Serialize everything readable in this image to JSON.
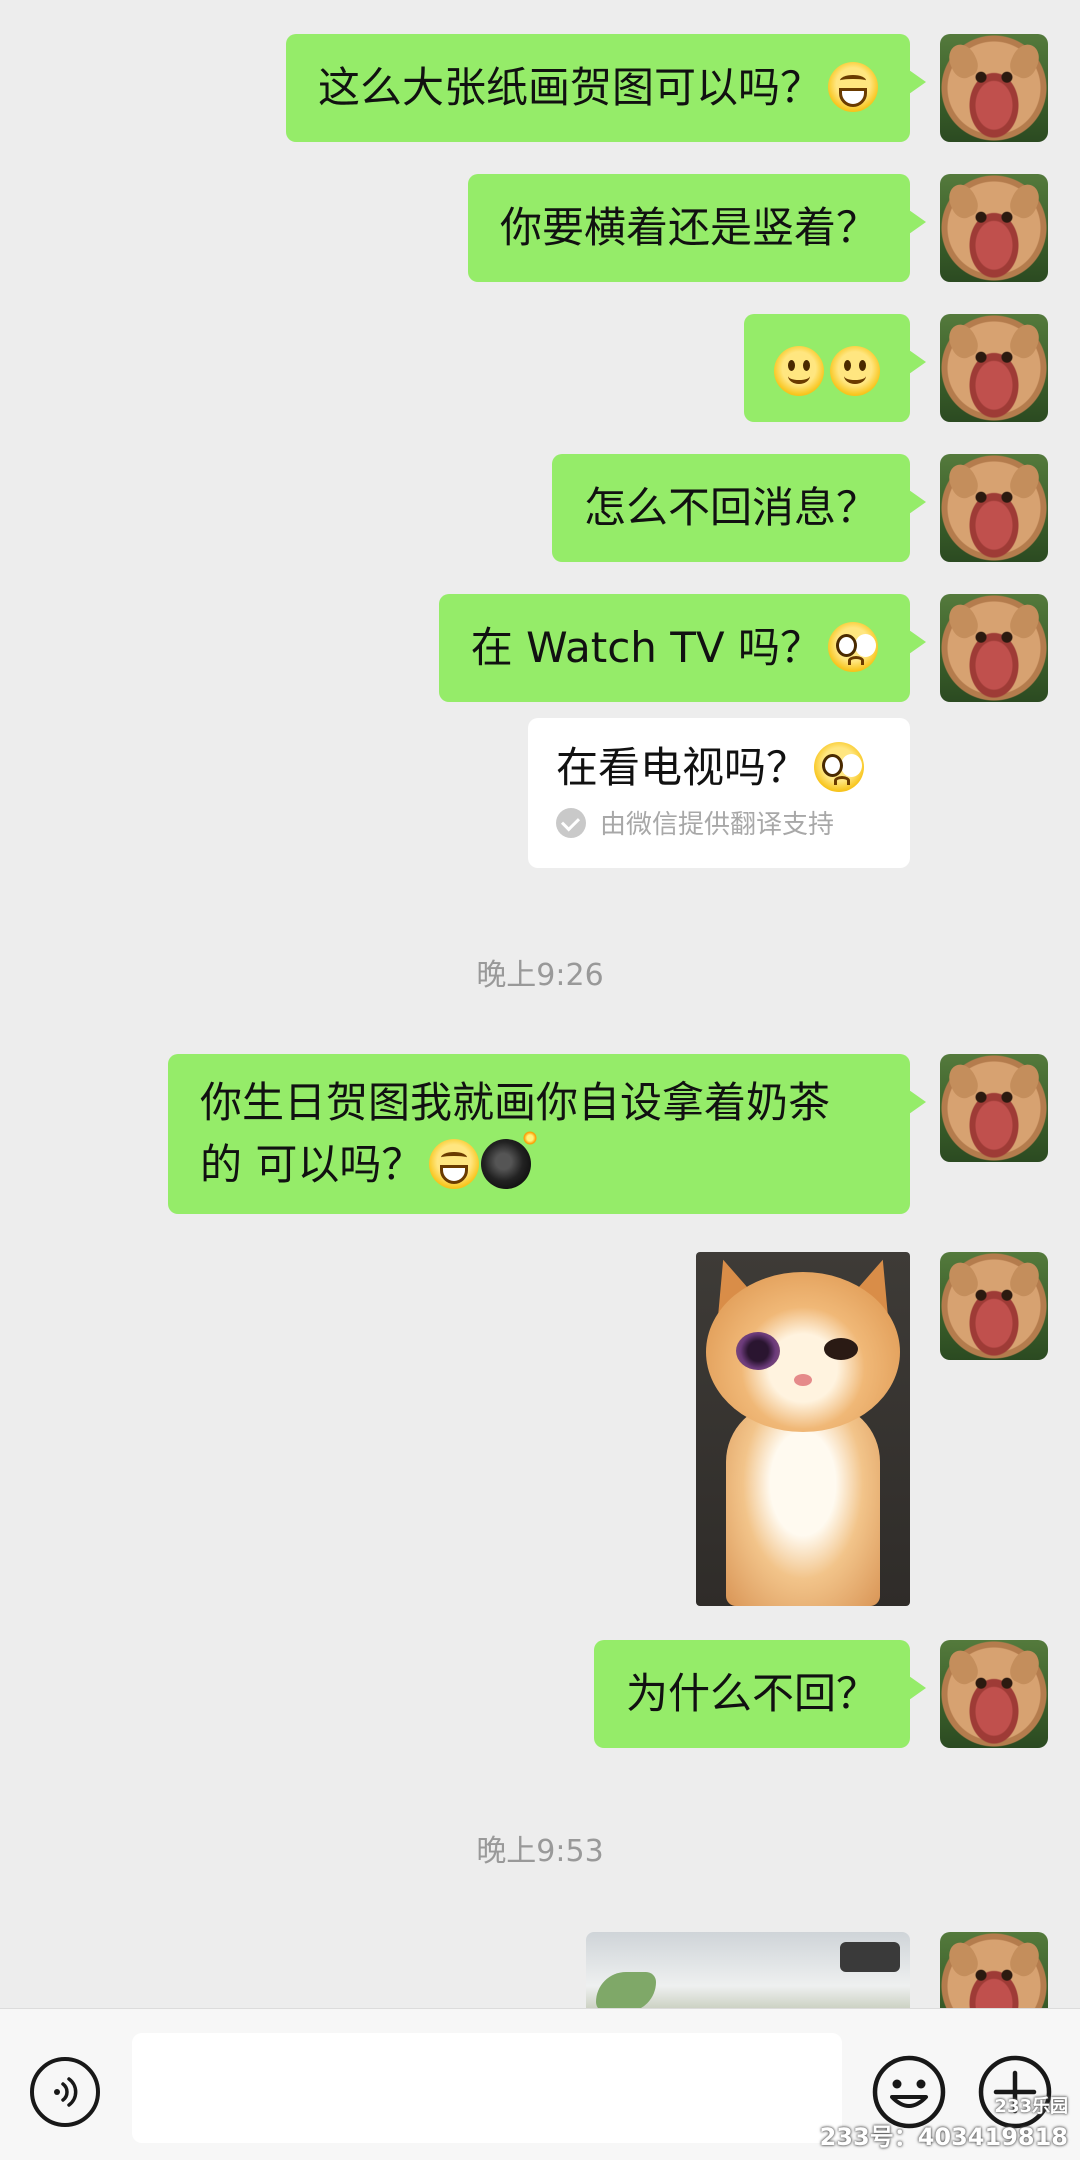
{
  "messages": [
    {
      "id": "m1",
      "text": "这么大张纸画贺图可以吗？",
      "emoji": "grin"
    },
    {
      "id": "m2",
      "text": "你要横着还是竖着？"
    },
    {
      "id": "m3",
      "text": "",
      "emoji": "smile-smile"
    },
    {
      "id": "m4",
      "text": "怎么不回消息？"
    },
    {
      "id": "m5",
      "text": "在 Watch TV 吗？",
      "emoji": "pleading"
    },
    {
      "id": "m6",
      "line1": "你生日贺图我就画你自设拿着奶茶",
      "line2": "的 可以吗？",
      "emoji": "grin-bomb"
    },
    {
      "id": "m7",
      "type": "image",
      "icon": "crying-cat-photo"
    },
    {
      "id": "m8",
      "text": "为什么不回？"
    },
    {
      "id": "m9",
      "type": "image",
      "icon": "desk-photo"
    }
  ],
  "translation": {
    "text": "在看电视吗？",
    "source": "由微信提供翻译支持"
  },
  "timestamps": {
    "t1": "晚上9:26",
    "t2": "晚上9:53"
  },
  "colors": {
    "bubble_green": "#95ec69",
    "background": "#ededed"
  },
  "watermark": {
    "logo": "233乐园",
    "id": "233号：403419818"
  }
}
